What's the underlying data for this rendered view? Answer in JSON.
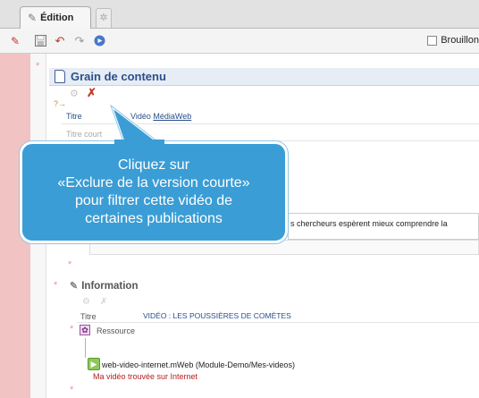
{
  "tabs": {
    "active_label": "Édition"
  },
  "toolbar": {
    "draft_label": "Brouillon",
    "icons": [
      "pencil-icon",
      "save-icon",
      "undo-icon",
      "redo-icon",
      "info-circle-icon"
    ]
  },
  "grain": {
    "title": "Grain de contenu",
    "title_label": "Titre",
    "title_value_prefix": "Vidéo",
    "title_value_link": "MédiaWeb",
    "short_title_label": "Titre court",
    "body_text": "s chercheurs espèrent mieux comprendre la"
  },
  "callout": {
    "line1": "Cliquez sur",
    "line2": "«Exclure de la version courte»",
    "line3": "pour filtrer cette vidéo de",
    "line4": "certaines publications"
  },
  "information": {
    "heading": "Information",
    "title_label": "Titre",
    "title_value": "VIDÉO : LES POUSSIÈRES DE COMÈTES",
    "resource_label": "Ressource",
    "file_name": "web-video-internet.mWeb",
    "file_path": "(Module-Demo/Mes-videos)",
    "file_note": "Ma vidéo trouvée sur Internet"
  },
  "colors": {
    "accent_blue": "#3a9dd5",
    "heading_blue": "#2d4f8c",
    "rail_pink": "#f2c3c3",
    "red": "#b52020"
  }
}
